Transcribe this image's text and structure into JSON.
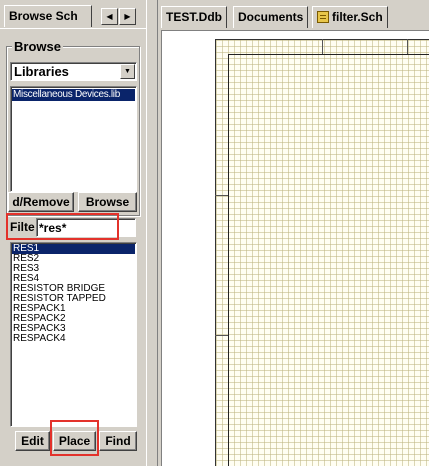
{
  "left_panel": {
    "tab_label": "Browse Sch",
    "nav": {
      "prev_icon": "triangle-left",
      "next_icon": "triangle-right"
    },
    "browse": {
      "group_title": "Browse",
      "type_select": {
        "value": "Libraries"
      },
      "libraries": [
        "Miscellaneous Devices.lib"
      ],
      "buttons": {
        "add_remove": "d/Remove",
        "browse": "Browse"
      }
    },
    "filter": {
      "label": "Filte",
      "value": "*res*"
    },
    "components": [
      "RES1",
      "RES2",
      "RES3",
      "RES4",
      "RESISTOR BRIDGE",
      "RESISTOR TAPPED",
      "RESPACK1",
      "RESPACK2",
      "RESPACK3",
      "RESPACK4"
    ],
    "selected_component": "RES1",
    "actions": {
      "edit": "Edit",
      "place": "Place",
      "find": "Find"
    },
    "highlight_color": "#e3322b"
  },
  "document_tabs": [
    {
      "label": "TEST.Ddb"
    },
    {
      "label": "Documents"
    },
    {
      "label": "filter.Sch",
      "icon": "schematic-sheet-icon"
    }
  ],
  "colors": {
    "selection": "#0a246a",
    "sheet_background": "#fffef2",
    "grid": "#beb482",
    "face": "#d4d0c8"
  }
}
